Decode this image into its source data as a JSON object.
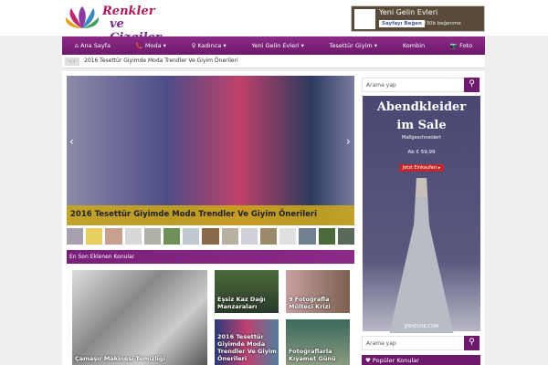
{
  "logo": {
    "line1": "Renkler",
    "line2": "ve Çizgiler"
  },
  "facebook": {
    "page_name": "Yeni Gelin Evleri",
    "like_button": "Sayfayı Beğen",
    "like_count": "230b beğenme"
  },
  "nav": [
    {
      "label": "Ana Sayfa",
      "icon": "home-icon"
    },
    {
      "label": "Moda ▾",
      "icon": "shoe-icon"
    },
    {
      "label": "Kadınca ▾",
      "icon": "woman-icon"
    },
    {
      "label": "Yeni Gelin Evleri ▾"
    },
    {
      "label": "Tesettür Giyim ▾"
    },
    {
      "label": "Kombin"
    },
    {
      "label": "Foto",
      "icon": "camera-icon"
    }
  ],
  "breadcrumb": {
    "arrows": "‹ ›",
    "text": "2016 Tesettür Giyimde Moda Trendler Ve Giyim Önerileri"
  },
  "slider": {
    "caption": "2016 Tesettür Giyimde Moda Trendler Ve Giyim Önerileri",
    "prev": "‹",
    "next": "›",
    "thumb_count": 15
  },
  "section": {
    "title": "En Son Eklenen Konular"
  },
  "posts": [
    "Çamaşır Makinesi Temizliği",
    "Eşsiz Kaz Dağı Manzaraları",
    "9 Fotoğrafla Mülteci Krizi",
    "2016 Tesettür Giyimde Moda Trendler Ve Giyim Önerileri",
    "Fotoğraflarla Kıyamet Günü"
  ],
  "search": {
    "placeholder": "Arama yap"
  },
  "ad": {
    "headline1": "Abendkleider",
    "headline2": "im Sale",
    "sub": "Maßgeschneidert",
    "price": "Ab € 59,99",
    "cta": "Jetzt Einkaufen ▸",
    "footer": "JJSHOUSE.COM"
  },
  "popular": {
    "title": "♥ Popüler Konular"
  }
}
